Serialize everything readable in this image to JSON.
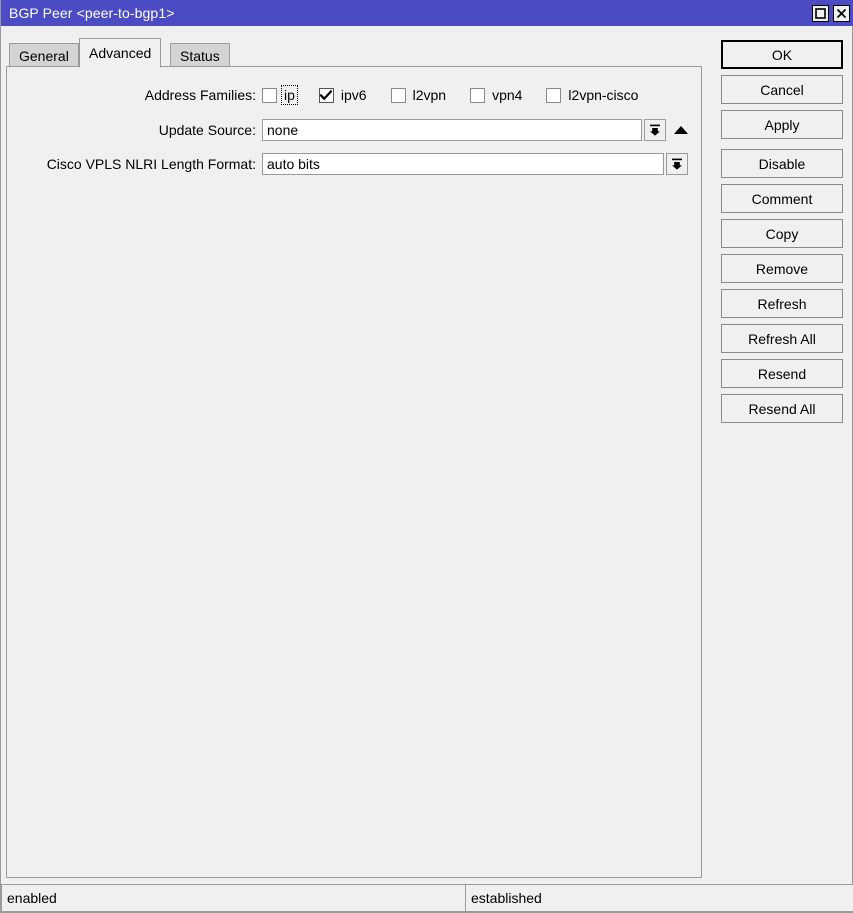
{
  "window": {
    "title": "BGP Peer <peer-to-bgp1>",
    "maximize_icon": "maximize-icon",
    "close_icon": "close-icon"
  },
  "tabs": [
    {
      "label": "General",
      "active": false
    },
    {
      "label": "Advanced",
      "active": true
    },
    {
      "label": "Status",
      "active": false
    }
  ],
  "form": {
    "address_families": {
      "label": "Address Families:",
      "options": [
        {
          "label": "ip",
          "checked": false,
          "focused": true
        },
        {
          "label": "ipv6",
          "checked": true,
          "focused": false
        },
        {
          "label": "l2vpn",
          "checked": false,
          "focused": false
        },
        {
          "label": "vpn4",
          "checked": false,
          "focused": false
        },
        {
          "label": "l2vpn-cisco",
          "checked": false,
          "focused": false
        }
      ]
    },
    "update_source": {
      "label": "Update Source:",
      "value": "none",
      "dropdown_icon": "dropdown-arrow-icon",
      "up_icon": "up-arrow-icon"
    },
    "cisco_vpls_nlri": {
      "label": "Cisco VPLS NLRI Length Format:",
      "value": "auto bits",
      "dropdown_icon": "dropdown-arrow-icon"
    }
  },
  "buttons": [
    {
      "label": "OK",
      "default": true
    },
    {
      "label": "Cancel",
      "default": false
    },
    {
      "label": "Apply",
      "default": false
    },
    {
      "label": "Disable",
      "default": false
    },
    {
      "label": "Comment",
      "default": false
    },
    {
      "label": "Copy",
      "default": false
    },
    {
      "label": "Remove",
      "default": false
    },
    {
      "label": "Refresh",
      "default": false
    },
    {
      "label": "Refresh All",
      "default": false
    },
    {
      "label": "Resend",
      "default": false
    },
    {
      "label": "Resend All",
      "default": false
    }
  ],
  "statusbar": {
    "left": "enabled",
    "right": "established"
  },
  "colors": {
    "titlebar": "#4b4bc4",
    "window_bg": "#f0f0f0",
    "tab_inactive": "#d4d4d4",
    "border": "#9a9a9a",
    "field_bg": "#ffffff"
  }
}
